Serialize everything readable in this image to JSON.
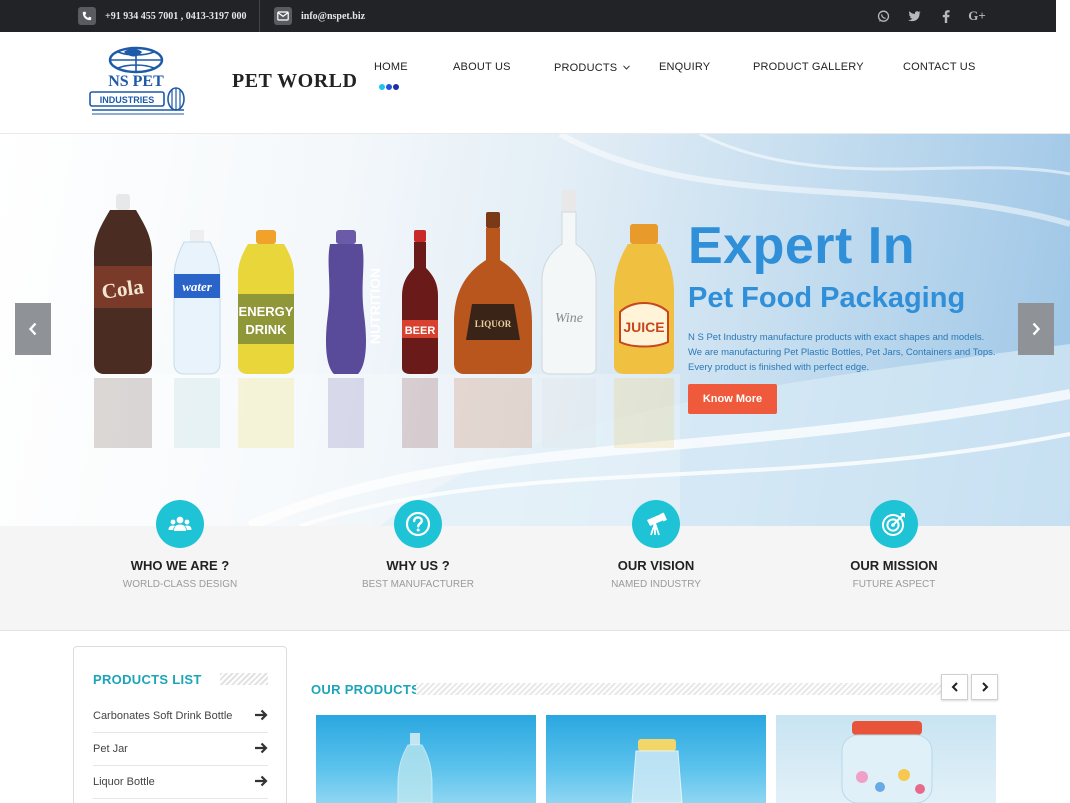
{
  "topbar": {
    "phone": "+91 934 455 7001 , 0413-3197 000",
    "email": "info@nspet.biz",
    "social": [
      "whatsapp-icon",
      "twitter-icon",
      "facebook-icon",
      "google-plus-icon"
    ]
  },
  "header": {
    "logo_text_top": "NS PET",
    "logo_text_bottom": "INDUSTRIES",
    "brand": "PET WORLD",
    "nav": [
      "HOME",
      "ABOUT US",
      "PRODUCTS",
      "ENQUIRY",
      "PRODUCT GALLERY",
      "CONTACT US"
    ],
    "active_nav": "HOME",
    "dot_colors": [
      "#1fc3f0",
      "#2255dd",
      "#1a2fa8"
    ]
  },
  "hero": {
    "title": "Expert In",
    "subtitle": "Pet Food Packaging",
    "desc_lines": [
      "N S Pet Industry manufacture products with exact shapes and models.",
      "We are manufacturing Pet Plastic Bottles, Pet Jars, Containers and Tops.",
      "Every product is finished with perfect edge."
    ],
    "button": "Know More",
    "bottle_labels": [
      "Cola",
      "water",
      "ENERGY DRINK",
      "NUTRITION",
      "BEER",
      "LIQUOR",
      "Wine",
      "JUICE"
    ]
  },
  "features": [
    {
      "title": "WHO WE ARE ?",
      "sub": "WORLD-CLASS DESIGN",
      "icon": "users-icon"
    },
    {
      "title": "WHY US ?",
      "sub": "BEST MANUFACTURER",
      "icon": "question-icon"
    },
    {
      "title": "OUR VISION",
      "sub": "NAMED INDUSTRY",
      "icon": "telescope-icon"
    },
    {
      "title": "OUR MISSION",
      "sub": "FUTURE ASPECT",
      "icon": "target-icon"
    }
  ],
  "products_list": {
    "title": "PRODUCTS LIST",
    "items": [
      "Carbonates Soft Drink Bottle",
      "Pet Jar",
      "Liquor Bottle"
    ]
  },
  "our_products": {
    "title": "OUR PRODUCTS",
    "prev": "‹",
    "next": "›"
  },
  "colors": {
    "accent": "#1fc3d6",
    "heading": "#1aa5b8",
    "hero_text": "#2f8fd8",
    "button": "#ef5a3c"
  }
}
